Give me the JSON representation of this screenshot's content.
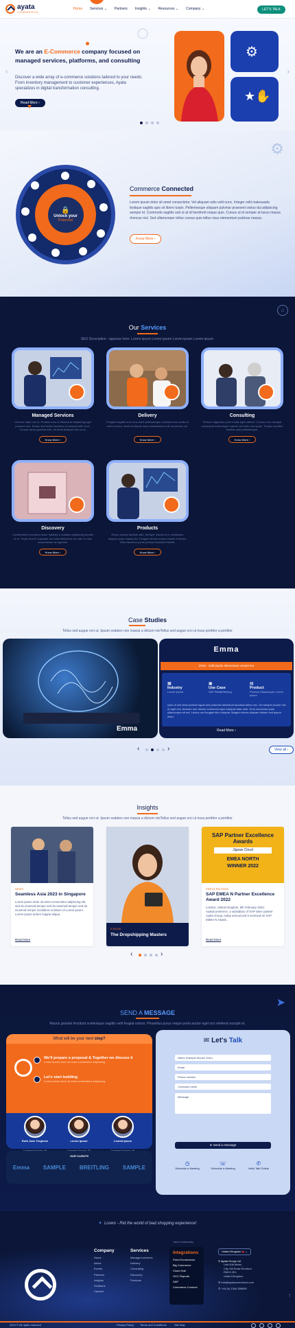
{
  "header": {
    "logo_name": "ayata",
    "logo_sub": "COMMERCE",
    "nav": [
      "Home",
      "Services",
      "Partners",
      "Insights",
      "Resources",
      "Company"
    ],
    "cta": "LET'S TALK"
  },
  "hero": {
    "title_pre": "We are an ",
    "title_highlight": "E-Commerce",
    "title_post": " company focused on managed services, platforms, and consulting",
    "text": "Discover a wide array of e-commerce solutions tailored to your needs. From inventory management to customer experiences, Ayata specializes in digital transformation consulting.",
    "button": "Read More"
  },
  "connected": {
    "wheel_line1": "Unlock your",
    "wheel_line2": "Potential",
    "title_a": "Commerce ",
    "title_b": "Connected",
    "text": "Lorem ipsum dolor sit amet consectetur. Vel aliquam odio velit nunc. Integer velit malesuada tristique sagittis quis sit libero turpis. Pellentesque aliquam pulvinar praesent varius dui adipiscing semper id. Commodo sagittis sed ut at id hendrerit neque quis. Cursus ut id semper at lacus massa rhoncus nisl. Sed ullamcorper tellus cursus quis tellus risus elementum pulvinar massa.",
    "button": "Know More"
  },
  "services": {
    "title_a": "Our ",
    "title_b": "Services",
    "subtitle": "SEO Description : appears here. Lorem ipsum Lorem ipsum Lorem ipsum Lorem ipsum.",
    "items": [
      {
        "title": "Managed Services",
        "text": "Ut tortor diam non in. Pretium eros in bibendum adipiscing eget posuere nec. Donec sed lectus faucibus ut volutpat nibh ut et. Cursus varius gravida odio, sit amet tristique nibh ut et.",
        "button": "Know More"
      },
      {
        "title": "Delivery",
        "text": "Fringilla sagittis eros eros amet pellentesque vehicula eros mollis at lorem auctor. Amet at blandit risus malesuada ut elit accumsan vel.",
        "button": "Know More"
      },
      {
        "title": "Consulting",
        "text": "Pretium dignissim proin mollis eget ultrices. Cursus eros volutpat consequat scelerisque mauris nisi lorem est quam. Tempor porttitor facilisis odio pellentesque.",
        "button": "Know More"
      },
      {
        "title": "Discovery",
        "text": "Condimentum tincidunt fusce habitant a sodales adipiscing lobortis ut et. Turpis auctor vulputate vel nulla bibendum vel odio. In duis suspendisse ac egestas.",
        "button": "Know More"
      },
      {
        "title": "Products",
        "text": "Risus montes facilisis odio. Semper mauris et in vestibulum aliquam justo mauris leo. Feugiat elit est cursus mauris id lectus. Vitae faucibus purus pretium tincidunt blandit.",
        "button": "Know More"
      }
    ]
  },
  "cases": {
    "title_a": "Case ",
    "title_b": "Studies",
    "subtitle": "Tellus sed augue orci ut. Ipsum sodales non massa a dictum nisiTellus sed augue orci ut risus porttitor a porttitor",
    "brand": "Emma",
    "image_brand": "Emma",
    "strip": "2018 - Sollicitudin elementum ornare leo",
    "col1_label": "Industry",
    "col1_value": "Lorem ipsum",
    "col2_label": "Use Case",
    "col2_value": "SAP Retail/Hilming",
    "col3_label": "Product",
    "col3_value": "Product Ullamcorper Lorem ipsum",
    "text": "Quis ut sed vitae pretium ligula sed pharetra bibendum faucibus tellus nec. Vel semper auctor nisl ut eget orci. Aenean non dictum commodo eget volutpat vitae ante. Eros commodo justo ullamcorper sit est. Lectus orci feugiat nibh volutpat. Magna viverra aliquam dictum sed ipsum dolor.",
    "read_more": "Read More",
    "view_all": "View all"
  },
  "insights": {
    "title": "Insights",
    "subtitle": "Tellus sed augue orci ut. Ipsum sodales non massa a dictum nisiTellus sed augue orci ut risus porttitor a porttitor",
    "items": [
      {
        "tag": "NEWS",
        "title": "Seamless Asia 2023 in Singapore",
        "text": "Lorem ipsum dolor sit amet consectetur adipiscing elit, sed do eiusmod tempor sed do eiusmod tempor sed do eiusmod tempor incididunt ut labore et Lorem ipsum. Lorem ipsum dolore magna aliqua.",
        "link": "Read More"
      },
      {
        "tag": "E-BOOK",
        "title": "The Dropshipping Masters",
        "text": "",
        "link": ""
      },
      {
        "tag": "PRESS RELEASE",
        "title": "SAP EMEA N Partner Excellence Award 2022",
        "text": "London, United Kingdom, 8th February 2022: AyataCommerce, a subsidiary of SAP silver partner Ayata Group, today announced it received an SAP EMEA N Award...",
        "link": "Read More",
        "award_top": "SAP Partner Excellence Awards",
        "award_mid": "Jigsaw Cloud",
        "award_region": "EMEA NORTH",
        "award_win": "WINNER 2022"
      }
    ]
  },
  "contact": {
    "title_a": "SEND A ",
    "title_b": "MESSAGE",
    "subtitle": "Mauris gravida tincidunt scelerisque sagittis velit feugiat rutrum. Phasellus purus neque porta auctor eget orci eleifend suscipit et.",
    "next_a": "What will be your next ",
    "next_b": "step?",
    "step1_title": "We'll prepare a proposal & Together we discuss it",
    "step1_text": "Lorem ipsum dolor sit amet consectetur adipiscing",
    "step2_title": "Let's start building",
    "step2_text": "Lorem ipsum dolor sit amet consectetur adipiscing",
    "team": [
      {
        "name": "Ruth Jane Torghese",
        "role": "Customer Support, UK"
      },
      {
        "name": "Lorem Ipsum",
        "role": "Customer Support, UK"
      },
      {
        "name": "Leonid Ipsum",
        "role": "Customer Support, UK"
      }
    ],
    "clients_label": "OUR CLIENTS",
    "clients": [
      "Emma",
      "SAMPLE",
      "BREITLING",
      "SAMPLE"
    ],
    "talk_a": "Let's ",
    "talk_b": "Talk",
    "fields": [
      "Name (Sample Mouse Over)",
      "Email",
      "Phone number",
      "Company name",
      "Message"
    ],
    "send": "Send a message",
    "contact_items": [
      "Schedule a Meeting",
      "Schedule a Meeting",
      "Hello Talk Online"
    ]
  },
  "tagline": "Lorem - Rid the world of bad shopping experience!",
  "footer": {
    "company_title": "Company",
    "company": [
      "Home",
      "About",
      "Events",
      "Partners",
      "Insights",
      "Solutions",
      "Careers"
    ],
    "services_title": "Services",
    "services": [
      "Managed services",
      "Delivery",
      "Consulting",
      "Discovery",
      "Products"
    ],
    "integrations_label": "New & Noteworthy",
    "integrations_title": "Integrations",
    "integrations": [
      "Fixed Ecommerce",
      "Big Commerce",
      "Cloud Hub",
      "OCC Reports",
      "SAP",
      "Commerce Connect"
    ],
    "locale": "United Kingdom",
    "company_name": "Ayata Group Ltd",
    "address": [
      "Unit 408 Metro",
      "City Hill Road Romford",
      "RM13 2EL",
      "United Kingdom"
    ],
    "email": "info@ayatacommerce.com",
    "phone": "+44 (0) 1344 356690",
    "copyright": "2024 © All rights reserved",
    "legal": [
      "Privacy Policy",
      "Terms and Conditions",
      "Site Map"
    ]
  },
  "colors": {
    "accent": "#f26a1b",
    "navy": "#0d1b4b",
    "blue": "#1c4bb8",
    "teal": "#0d8f7c"
  }
}
